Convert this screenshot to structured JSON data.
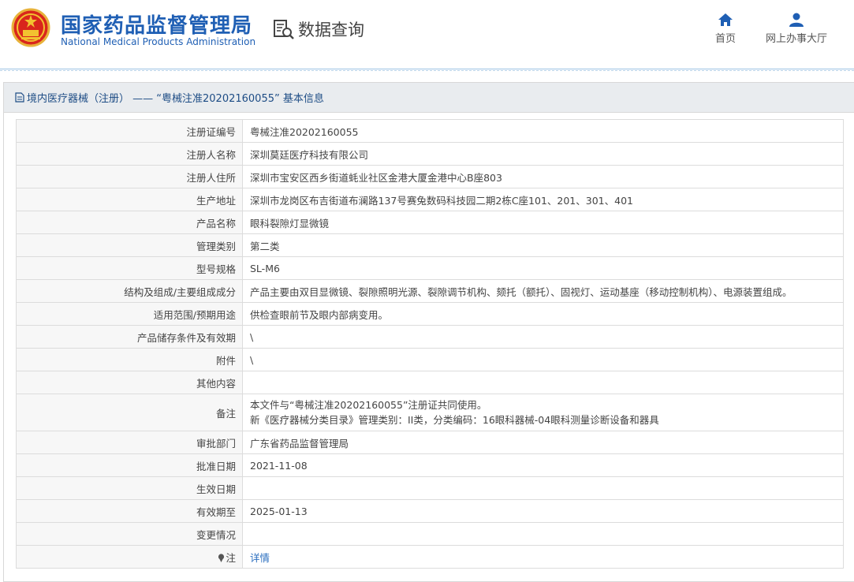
{
  "header": {
    "title_cn": "国家药品监督管理局",
    "title_en": "National Medical Products Administration",
    "query_label": "数据查询",
    "nav": [
      {
        "label": "首页",
        "icon": "home-icon"
      },
      {
        "label": "网上办事大厅",
        "icon": "user-icon"
      }
    ],
    "brand_color": "#1f5fb4"
  },
  "panel": {
    "heading": "境内医疗器械（注册） ——  “粤械注准20202160055” 基本信息"
  },
  "rows": [
    {
      "label": "注册证编号",
      "value": "粤械注准20202160055"
    },
    {
      "label": "注册人名称",
      "value": "深圳莫廷医疗科技有限公司"
    },
    {
      "label": "注册人住所",
      "value": "深圳市宝安区西乡街道蚝业社区金港大厦金港中心B座803"
    },
    {
      "label": "生产地址",
      "value": "深圳市龙岗区布吉街道布澜路137号赛兔数码科技园二期2栋C座101、201、301、401"
    },
    {
      "label": "产品名称",
      "value": "眼科裂隙灯显微镜"
    },
    {
      "label": "管理类别",
      "value": "第二类"
    },
    {
      "label": "型号规格",
      "value": "SL-M6"
    },
    {
      "label": "结构及组成/主要组成成分",
      "value": "产品主要由双目显微镜、裂隙照明光源、裂隙调节机构、颏托（额托）、固视灯、运动基座（移动控制机构）、电源装置组成。"
    },
    {
      "label": "适用范围/预期用途",
      "value": "供检查眼前节及眼内部病变用。"
    },
    {
      "label": "产品储存条件及有效期",
      "value": "\\"
    },
    {
      "label": "附件",
      "value": "\\"
    },
    {
      "label": "其他内容",
      "value": ""
    },
    {
      "label": "备注",
      "value_line1": "本文件与“粤械注准20202160055”注册证共同使用。",
      "value_line2": "新《医疗器械分类目录》管理类别：II类，分类编码：16眼科器械-04眼科测量诊断设备和器具"
    },
    {
      "label": "审批部门",
      "value": "广东省药品监督管理局"
    },
    {
      "label": "批准日期",
      "value": "2021-11-08"
    },
    {
      "label": "生效日期",
      "value": ""
    },
    {
      "label": "有效期至",
      "value": "2025-01-13"
    },
    {
      "label": "变更情况",
      "value": ""
    },
    {
      "label": "注",
      "value": "详情"
    }
  ]
}
